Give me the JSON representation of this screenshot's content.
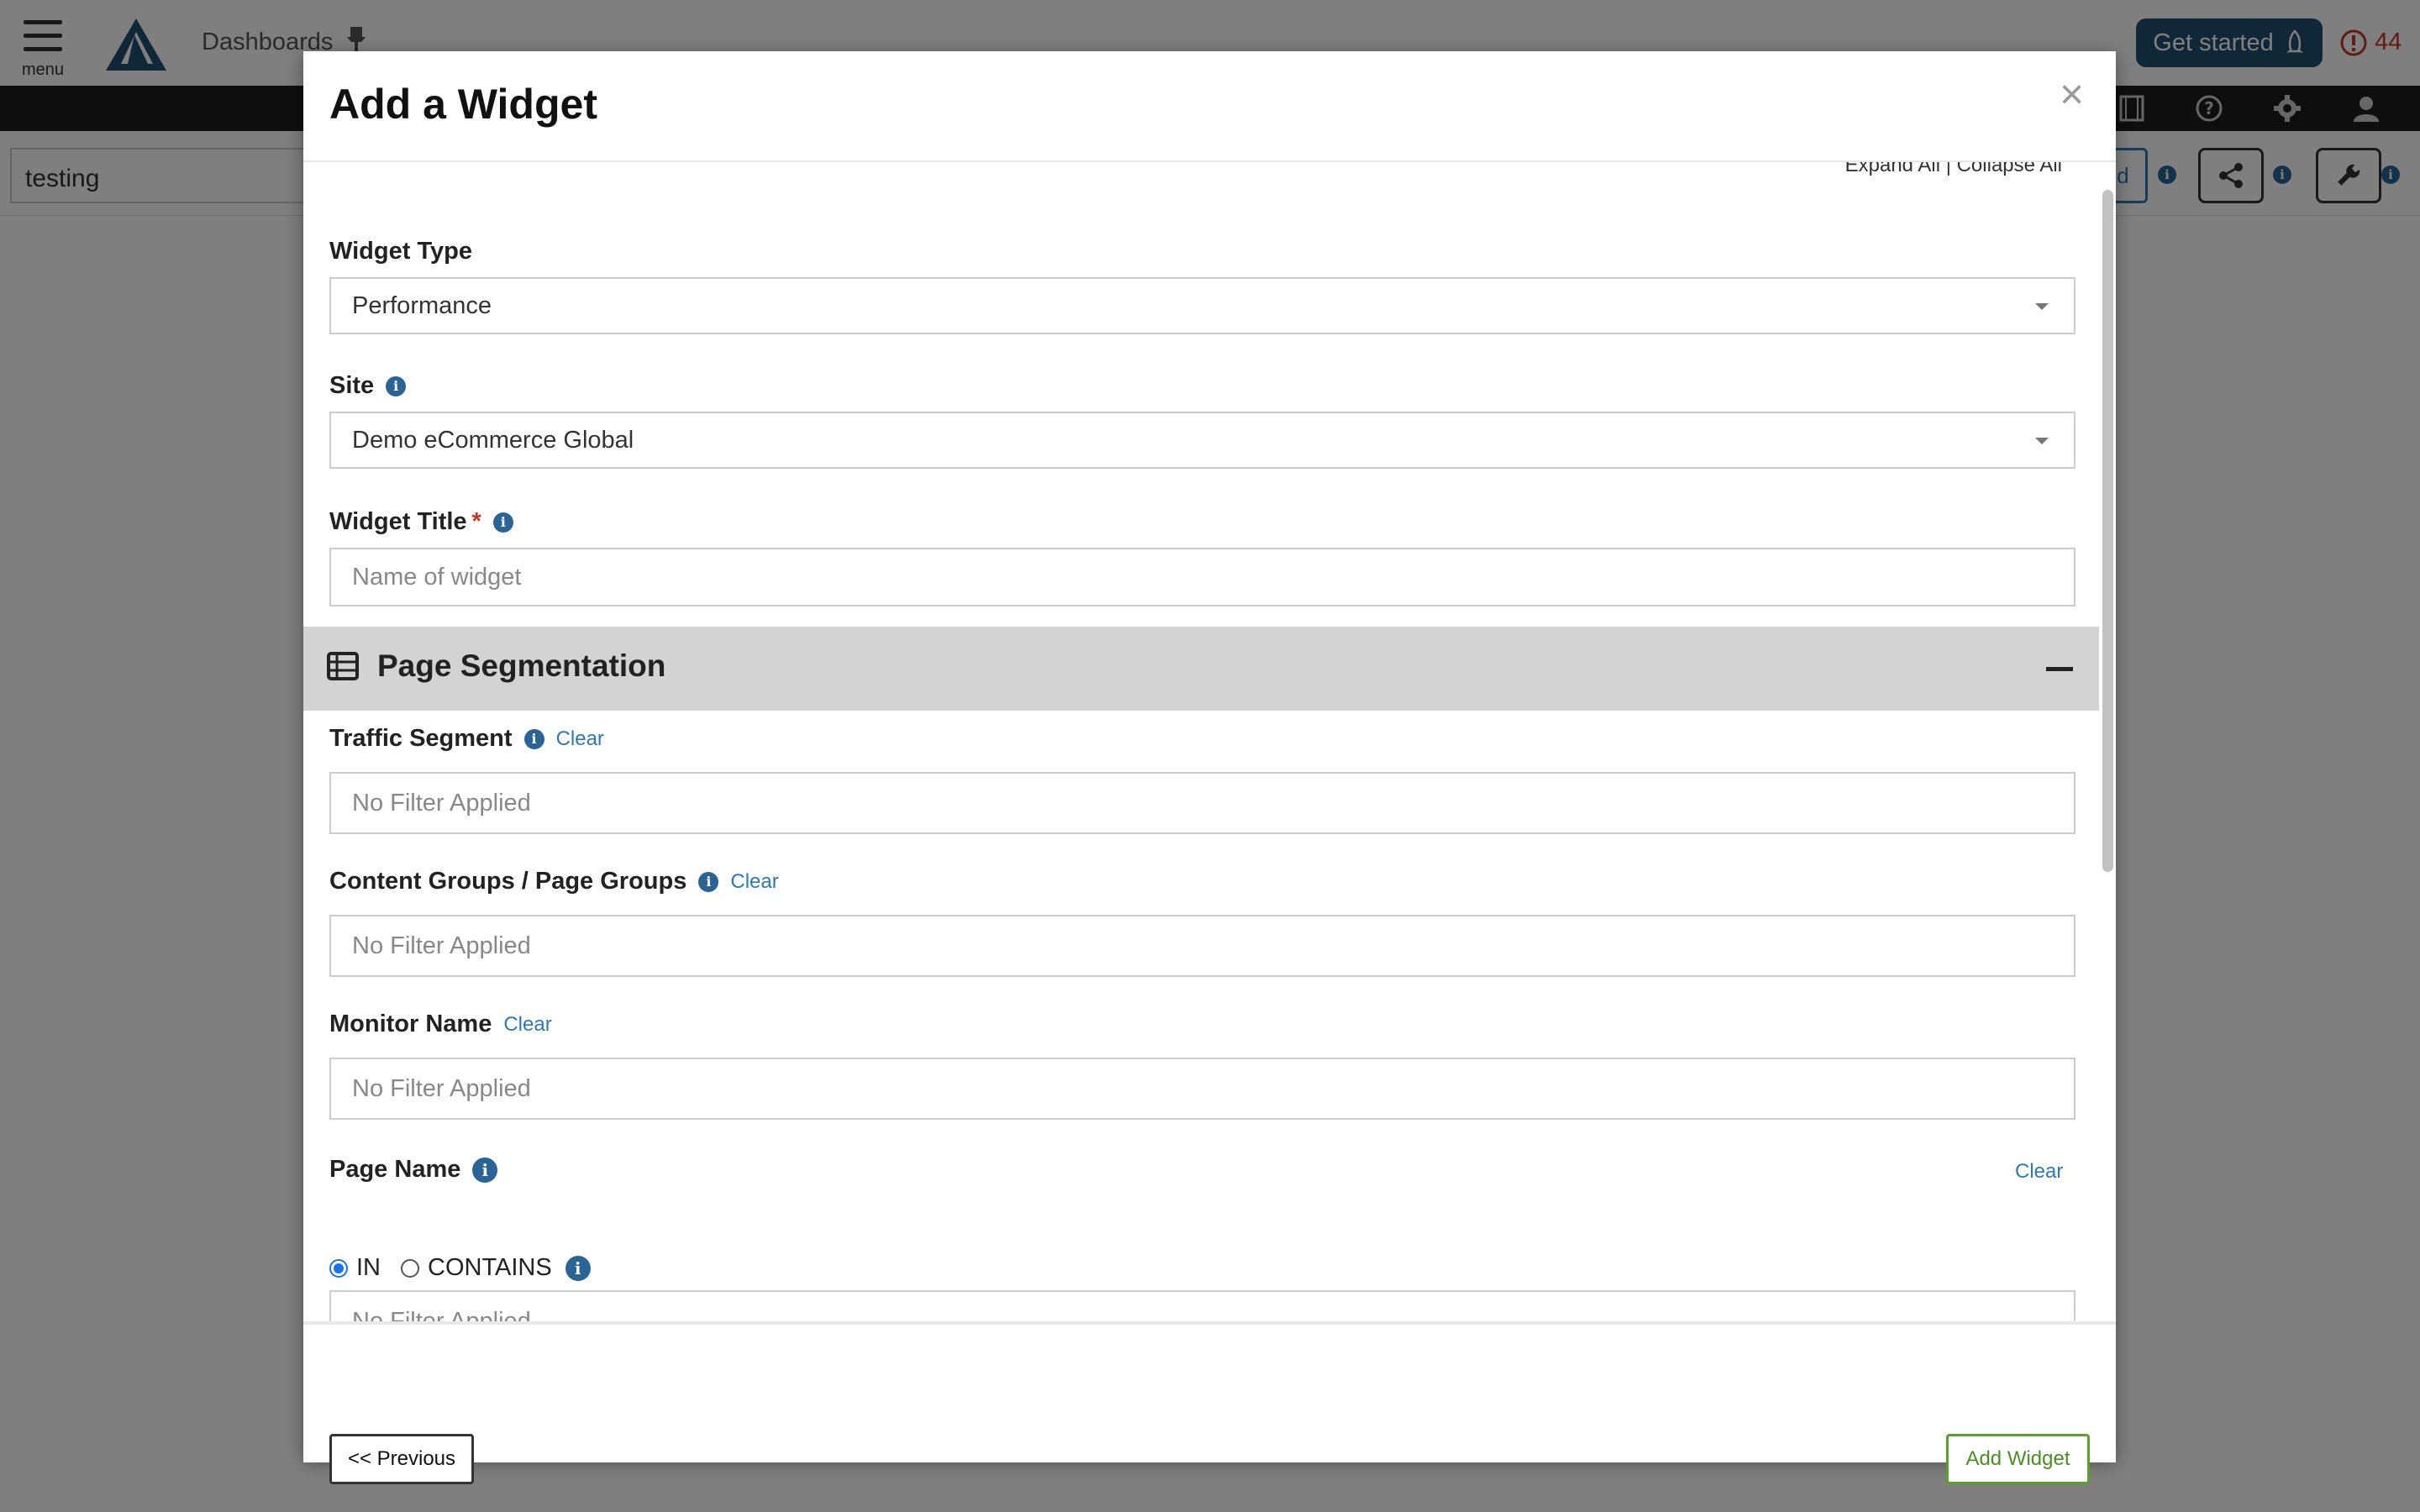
{
  "app": {
    "menu_label": "menu",
    "breadcrumb": "Dashboards",
    "get_started_label": "Get started",
    "alert_count": "44",
    "dashboard_name": "testing",
    "background_button_fragment": "d"
  },
  "modal": {
    "title": "Add a Widget",
    "close_label": "×",
    "expand_collapse": "Expand All | Collapse All",
    "fields": {
      "widget_type": {
        "label": "Widget Type",
        "value": "Performance"
      },
      "site": {
        "label": "Site",
        "value": "Demo eCommerce Global"
      },
      "widget_title": {
        "label": "Widget Title",
        "required_mark": "*",
        "placeholder": "Name of widget"
      }
    },
    "section": {
      "title": "Page Segmentation",
      "collapse_label": "−"
    },
    "filters": {
      "traffic_segment": {
        "label": "Traffic Segment",
        "clear": "Clear",
        "value": "No Filter Applied"
      },
      "content_groups": {
        "label": "Content Groups / Page Groups",
        "clear": "Clear",
        "value": "No Filter Applied"
      },
      "monitor_name": {
        "label": "Monitor Name",
        "clear": "Clear",
        "value": "No Filter Applied"
      },
      "page_name": {
        "label": "Page Name",
        "clear": "Clear",
        "radio_in": "IN",
        "radio_contains": "CONTAINS",
        "selected": "IN",
        "value": "No Filter Applied"
      }
    },
    "footer": {
      "previous_label": "<< Previous",
      "add_label": "Add Widget"
    }
  },
  "colors": {
    "accent_blue": "#2a7ab8",
    "info_icon": "#2a6496",
    "add_button_green": "#5aa02c",
    "required_red": "#c0392b",
    "section_header_bg": "#d3d3d3",
    "get_started_bg": "#1f4e6e"
  }
}
